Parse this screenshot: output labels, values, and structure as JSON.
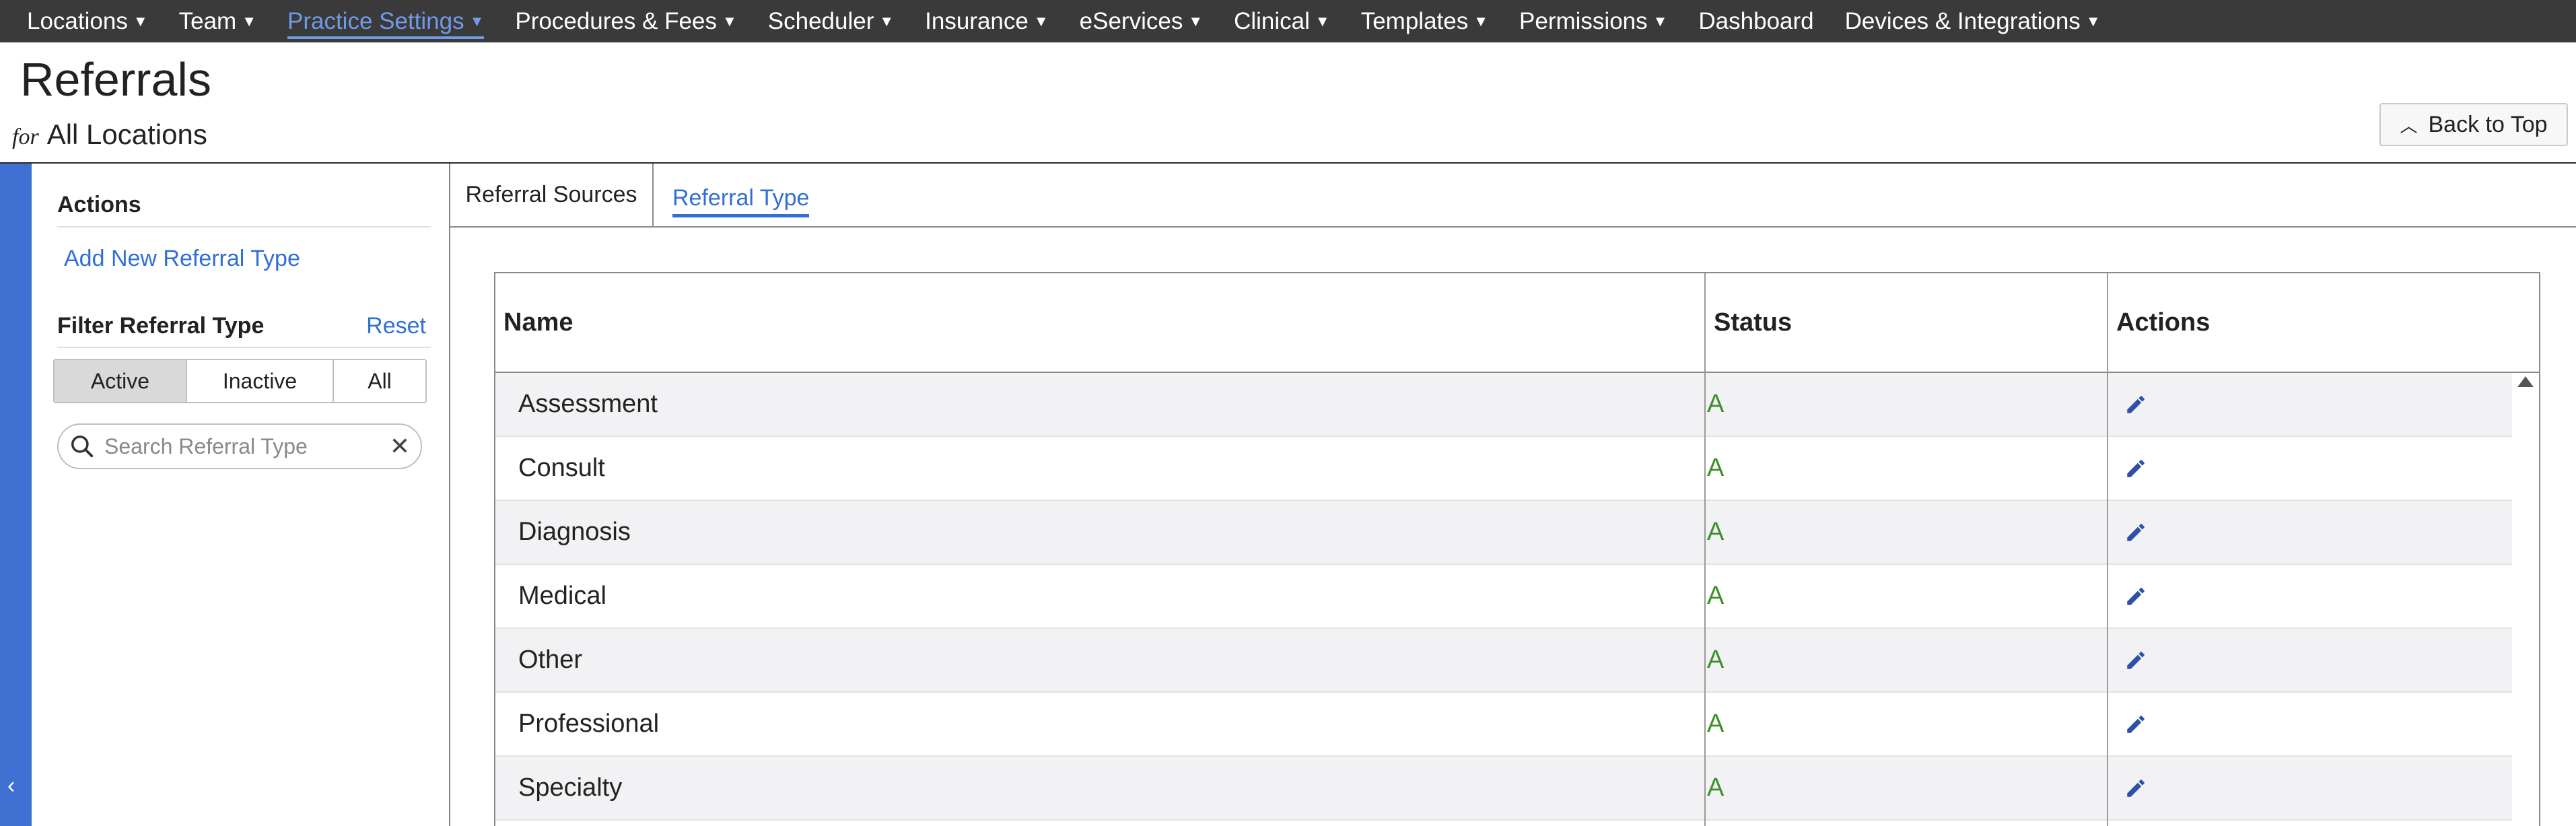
{
  "nav": {
    "items": [
      {
        "label": "Locations",
        "caret": true,
        "active": false
      },
      {
        "label": "Team",
        "caret": true,
        "active": false
      },
      {
        "label": "Practice Settings",
        "caret": true,
        "active": true
      },
      {
        "label": "Procedures & Fees",
        "caret": true,
        "active": false
      },
      {
        "label": "Scheduler",
        "caret": true,
        "active": false
      },
      {
        "label": "Insurance",
        "caret": true,
        "active": false
      },
      {
        "label": "eServices",
        "caret": true,
        "active": false
      },
      {
        "label": "Clinical",
        "caret": true,
        "active": false
      },
      {
        "label": "Templates",
        "caret": true,
        "active": false
      },
      {
        "label": "Permissions",
        "caret": true,
        "active": false
      },
      {
        "label": "Dashboard",
        "caret": false,
        "active": false
      },
      {
        "label": "Devices & Integrations",
        "caret": true,
        "active": false
      }
    ]
  },
  "header": {
    "title": "Referrals",
    "for_label": "for",
    "location": "All Locations",
    "back_to_top": "Back to Top"
  },
  "sidebar": {
    "actions_heading": "Actions",
    "add_link": "Add New Referral Type",
    "filter_heading": "Filter Referral Type",
    "reset": "Reset",
    "filter_options": [
      "Active",
      "Inactive",
      "All"
    ],
    "selected_filter": "Active",
    "search_placeholder": "Search Referral Type",
    "search_value": ""
  },
  "tabs": {
    "sources": "Referral Sources",
    "type": "Referral Type",
    "active": "Referral Type"
  },
  "table": {
    "headers": {
      "name": "Name",
      "status": "Status",
      "actions": "Actions"
    },
    "rows": [
      {
        "name": "Assessment",
        "status": "A"
      },
      {
        "name": "Consult",
        "status": "A"
      },
      {
        "name": "Diagnosis",
        "status": "A"
      },
      {
        "name": "Medical",
        "status": "A"
      },
      {
        "name": "Other",
        "status": "A"
      },
      {
        "name": "Professional",
        "status": "A"
      },
      {
        "name": "Specialty",
        "status": "A"
      }
    ]
  },
  "colors": {
    "nav_bg": "#3a3a3a",
    "accent": "#2f6fd6",
    "rail": "#3f6fd1",
    "status_active": "#3f8f2a"
  }
}
